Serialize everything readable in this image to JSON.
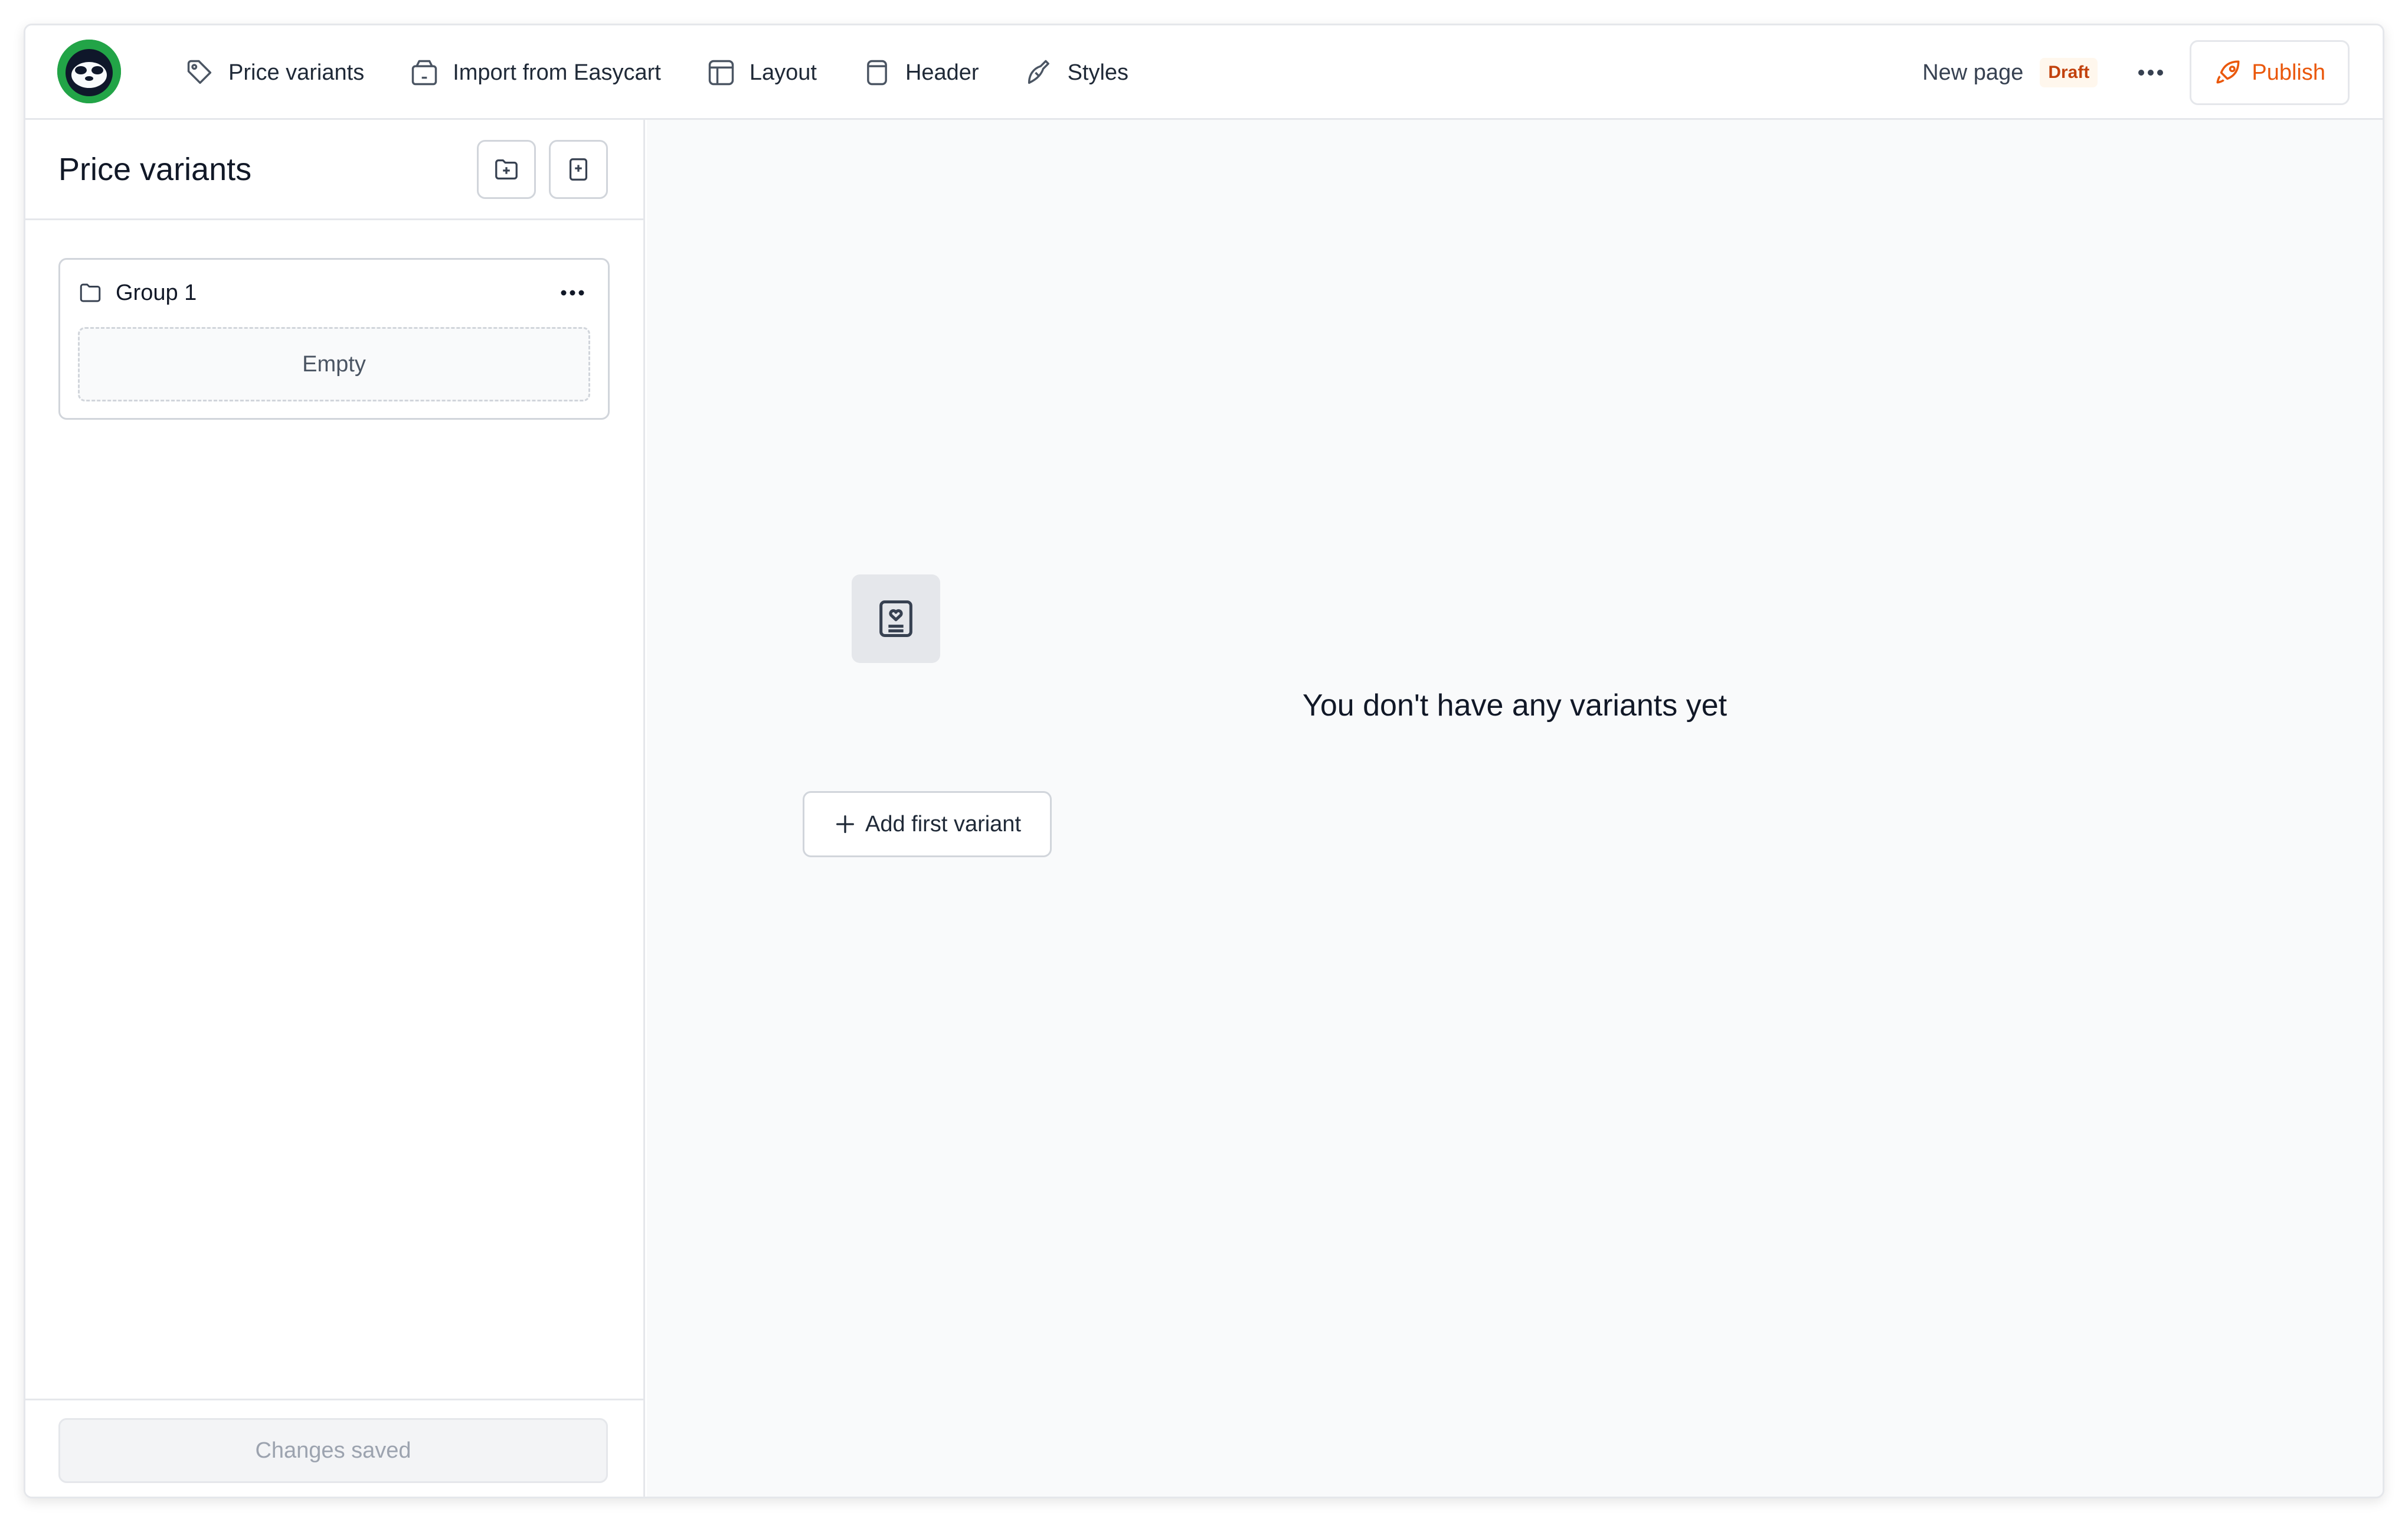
{
  "topbar": {
    "nav": [
      {
        "label": "Price variants",
        "icon": "tag-icon"
      },
      {
        "label": "Import from Easycart",
        "icon": "wallet-icon"
      },
      {
        "label": "Layout",
        "icon": "layout-icon"
      },
      {
        "label": "Header",
        "icon": "header-icon"
      },
      {
        "label": "Styles",
        "icon": "brush-icon"
      }
    ],
    "page_name": "New page",
    "status_badge": "Draft",
    "publish_label": "Publish"
  },
  "sidebar": {
    "title": "Price variants",
    "groups": [
      {
        "name": "Group 1",
        "empty_label": "Empty"
      }
    ],
    "footer_status": "Changes saved"
  },
  "main": {
    "empty_message": "You don't have any variants yet",
    "add_button_label": "Add first variant"
  },
  "colors": {
    "accent": "#ea580c",
    "logo": "#16a34a",
    "draft_badge_bg": "#fff7ed",
    "main_bg": "#f9fafb"
  }
}
